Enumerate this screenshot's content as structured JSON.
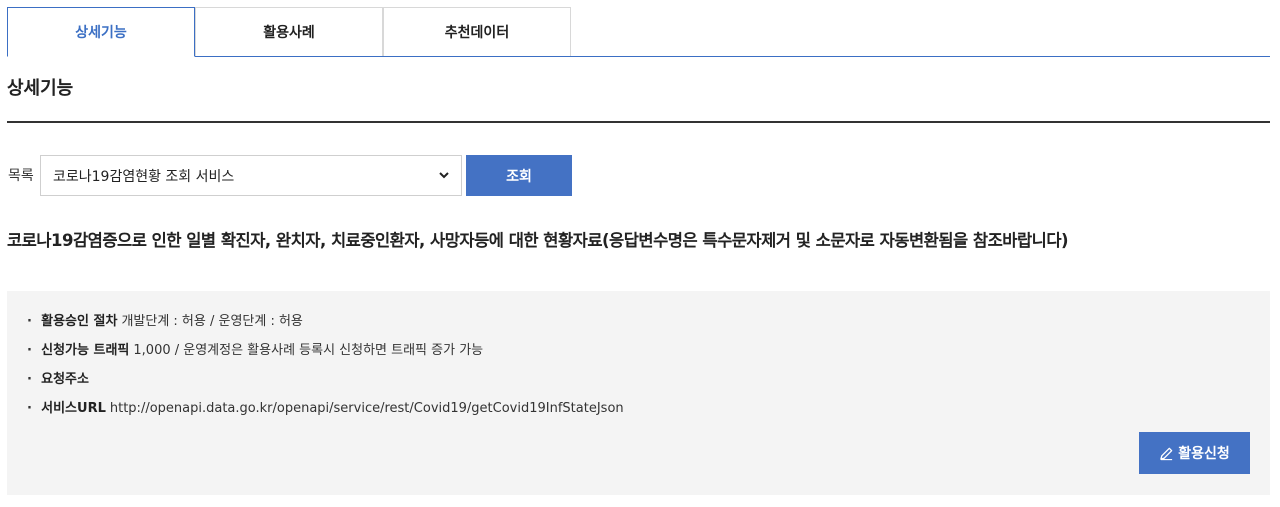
{
  "tabs": [
    {
      "label": "상세기능",
      "active": true
    },
    {
      "label": "활용사례",
      "active": false
    },
    {
      "label": "추천데이터",
      "active": false
    }
  ],
  "section_title": "상세기능",
  "list": {
    "label": "목록",
    "selected": "코로나19감염현황 조회 서비스",
    "search_label": "조회"
  },
  "description": "코로나19감염증으로 인한 일별 확진자, 완치자, 치료중인환자, 사망자등에 대한 현황자료(응답변수명은 특수문자제거 및 소문자로 자동변환됨을 참조바랍니다)",
  "info": {
    "approval": {
      "label": "활용승인 절차",
      "value": "개발단계 : 허용 / 운영단계 : 허용"
    },
    "traffic": {
      "label": "신청가능 트래픽",
      "value": "1,000 / 운영계정은 활용사례 등록시 신청하면 트래픽 증가 가능"
    },
    "request_url": {
      "label": "요청주소",
      "value": ""
    },
    "service_url": {
      "label": "서비스URL",
      "value": "http://openapi.data.go.kr/openapi/service/rest/Covid19/getCovid19InfStateJson"
    }
  },
  "apply_button": {
    "label": "활용신청",
    "icon": "pencil-icon"
  },
  "colors": {
    "accent": "#4472c4",
    "panel_bg": "#f4f4f4"
  }
}
